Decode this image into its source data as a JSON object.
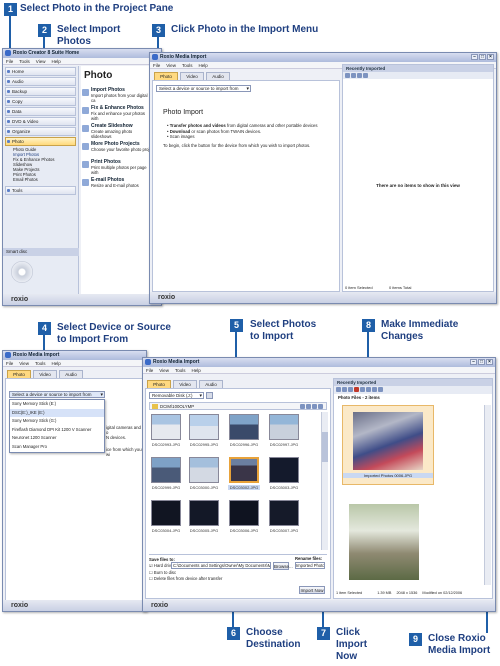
{
  "callouts": {
    "c1": {
      "num": "1",
      "text": "Select Photo in the Project Pane"
    },
    "c2": {
      "num": "2",
      "line1": "Select Import",
      "line2": "Photos"
    },
    "c3": {
      "num": "3",
      "text": "Click Photo in the Import Menu"
    },
    "c4": {
      "num": "4",
      "line1": "Select Device or Source",
      "line2": "to Import From"
    },
    "c5": {
      "num": "5",
      "line1": "Select Photos",
      "line2": "to Import"
    },
    "c6": {
      "num": "6",
      "line1": "Choose",
      "line2": "Destination"
    },
    "c7": {
      "num": "7",
      "line1": "Click",
      "line2": "Import",
      "line3": "Now"
    },
    "c8": {
      "num": "8",
      "line1": "Make Immediate",
      "line2": "Changes"
    },
    "c9": {
      "num": "9",
      "line1": "Close Roxio",
      "line2": "Media Import"
    }
  },
  "suite_window": {
    "title": "Roxio Creator 8 Suite Home",
    "menu": [
      "File",
      "Tools",
      "View",
      "Help"
    ],
    "nav": [
      "Home",
      "Audio",
      "Backup",
      "Copy",
      "Data",
      "DVD & Video",
      "Organize",
      "Photo"
    ],
    "photo_sub": [
      "Photo Guide",
      "Import Photos",
      "Fix & Enhance Photos",
      "Slideshow",
      "Make Projects",
      "Print Photos",
      "Email Photos"
    ],
    "tools": "Tools",
    "smart_disc": "Smart disc",
    "main_title": "Photo",
    "tasks": [
      {
        "title": "Import Photos",
        "desc": "Import photos from your digital ca"
      },
      {
        "title": "Fix & Enhance Photos",
        "desc": "Fix and enhance your photos with"
      },
      {
        "title": "Create Slideshow",
        "desc": "Create amazing photo slideshows"
      },
      {
        "title": "More Photo Projects",
        "desc": "Choose your favorite photo proj"
      },
      {
        "title": "Print Photos",
        "desc": "Print multiple photos per page with"
      },
      {
        "title": "E-mail Photos",
        "desc": "Resize and E-mail photos"
      }
    ],
    "footer": "roxio"
  },
  "import1": {
    "title": "Roxio Media Import",
    "menu": [
      "File",
      "View",
      "Tools",
      "Help"
    ],
    "tabs": [
      "Photo",
      "Video",
      "Audio"
    ],
    "device_select": "Select a device or source to import from",
    "heading": "Photo Import",
    "bullets": [
      {
        "bold": "Transfer photos and videos",
        "rest": " from digital cameras and other portable devices"
      },
      {
        "bold": "Download",
        "rest": " or scan photos from TWAIN devices."
      },
      {
        "bold": "",
        "rest": "Scan images"
      }
    ],
    "instruction": "To begin, click the button for the device from which you wish to import photos.",
    "recent_label": "Recently Imported",
    "empty_msg": "There are no items to show in this view",
    "status_left": "0 item Selected",
    "status_right": "0 items Total",
    "footer": "roxio"
  },
  "import2": {
    "title": "Roxio Media Import",
    "menu": [
      "File",
      "View",
      "Tools",
      "Help"
    ],
    "tabs": [
      "Photo",
      "Video",
      "Audio"
    ],
    "device_select": "Select a device or source to import from",
    "devices": [
      "Sony Memory Stick (E:)",
      "DSC(E:)_IKE (E:)",
      "Sony Memory Stick (G:)",
      "Fireflash Diamond DPI Kit 1200 V Scanner",
      "Neuronet 1200 Scanner",
      "Scan Manager Pro"
    ],
    "bg_text1": "igital cameras and o",
    "bg_text2": "N devices.",
    "bg_text3": "ice from which you wi",
    "footer": "roxio"
  },
  "import3": {
    "title": "Roxio Media Import",
    "menu": [
      "File",
      "View",
      "Tools",
      "Help"
    ],
    "tabs": [
      "Photo",
      "Video",
      "Audio"
    ],
    "device_select": "Removable Disk (J:)",
    "folder": "DCIM\\100OLYMP",
    "captions": [
      "DSC02993.JPG",
      "DSC02995.JPG",
      "DSC02996.JPG",
      "DSC02997.JPG",
      "DSC02999.JPG",
      "DSC03000.JPG",
      "DSC03002.JPG",
      "DSC03003.JPG",
      "DSC03004.JPG",
      "DSC03005.JPG",
      "DSC03006.JPG",
      "DSC03007.JPG"
    ],
    "save_label": "Save files to:",
    "hard_drive": "Hard drive",
    "path": "C:\\Documents and Settings\\Owner\\My Documents\\My Pictures",
    "rename_label": "Rename files:",
    "rename_value": "Imported Photos",
    "burn": "Burn to disc",
    "delete": "Delete files from device after transfer",
    "browse": "Browse...",
    "import_now": "Import Now",
    "footer": "roxio",
    "recent_label": "Recently Imported",
    "photo_filter": "Photo Files - 2 items",
    "selected_caption": "Imported Photos 0006.JPG",
    "status_left": "1 item Selected",
    "status_size": "1.39 MB",
    "status_dims": "2048 x 1536",
    "status_date": "Modified on 02/12/2006"
  }
}
